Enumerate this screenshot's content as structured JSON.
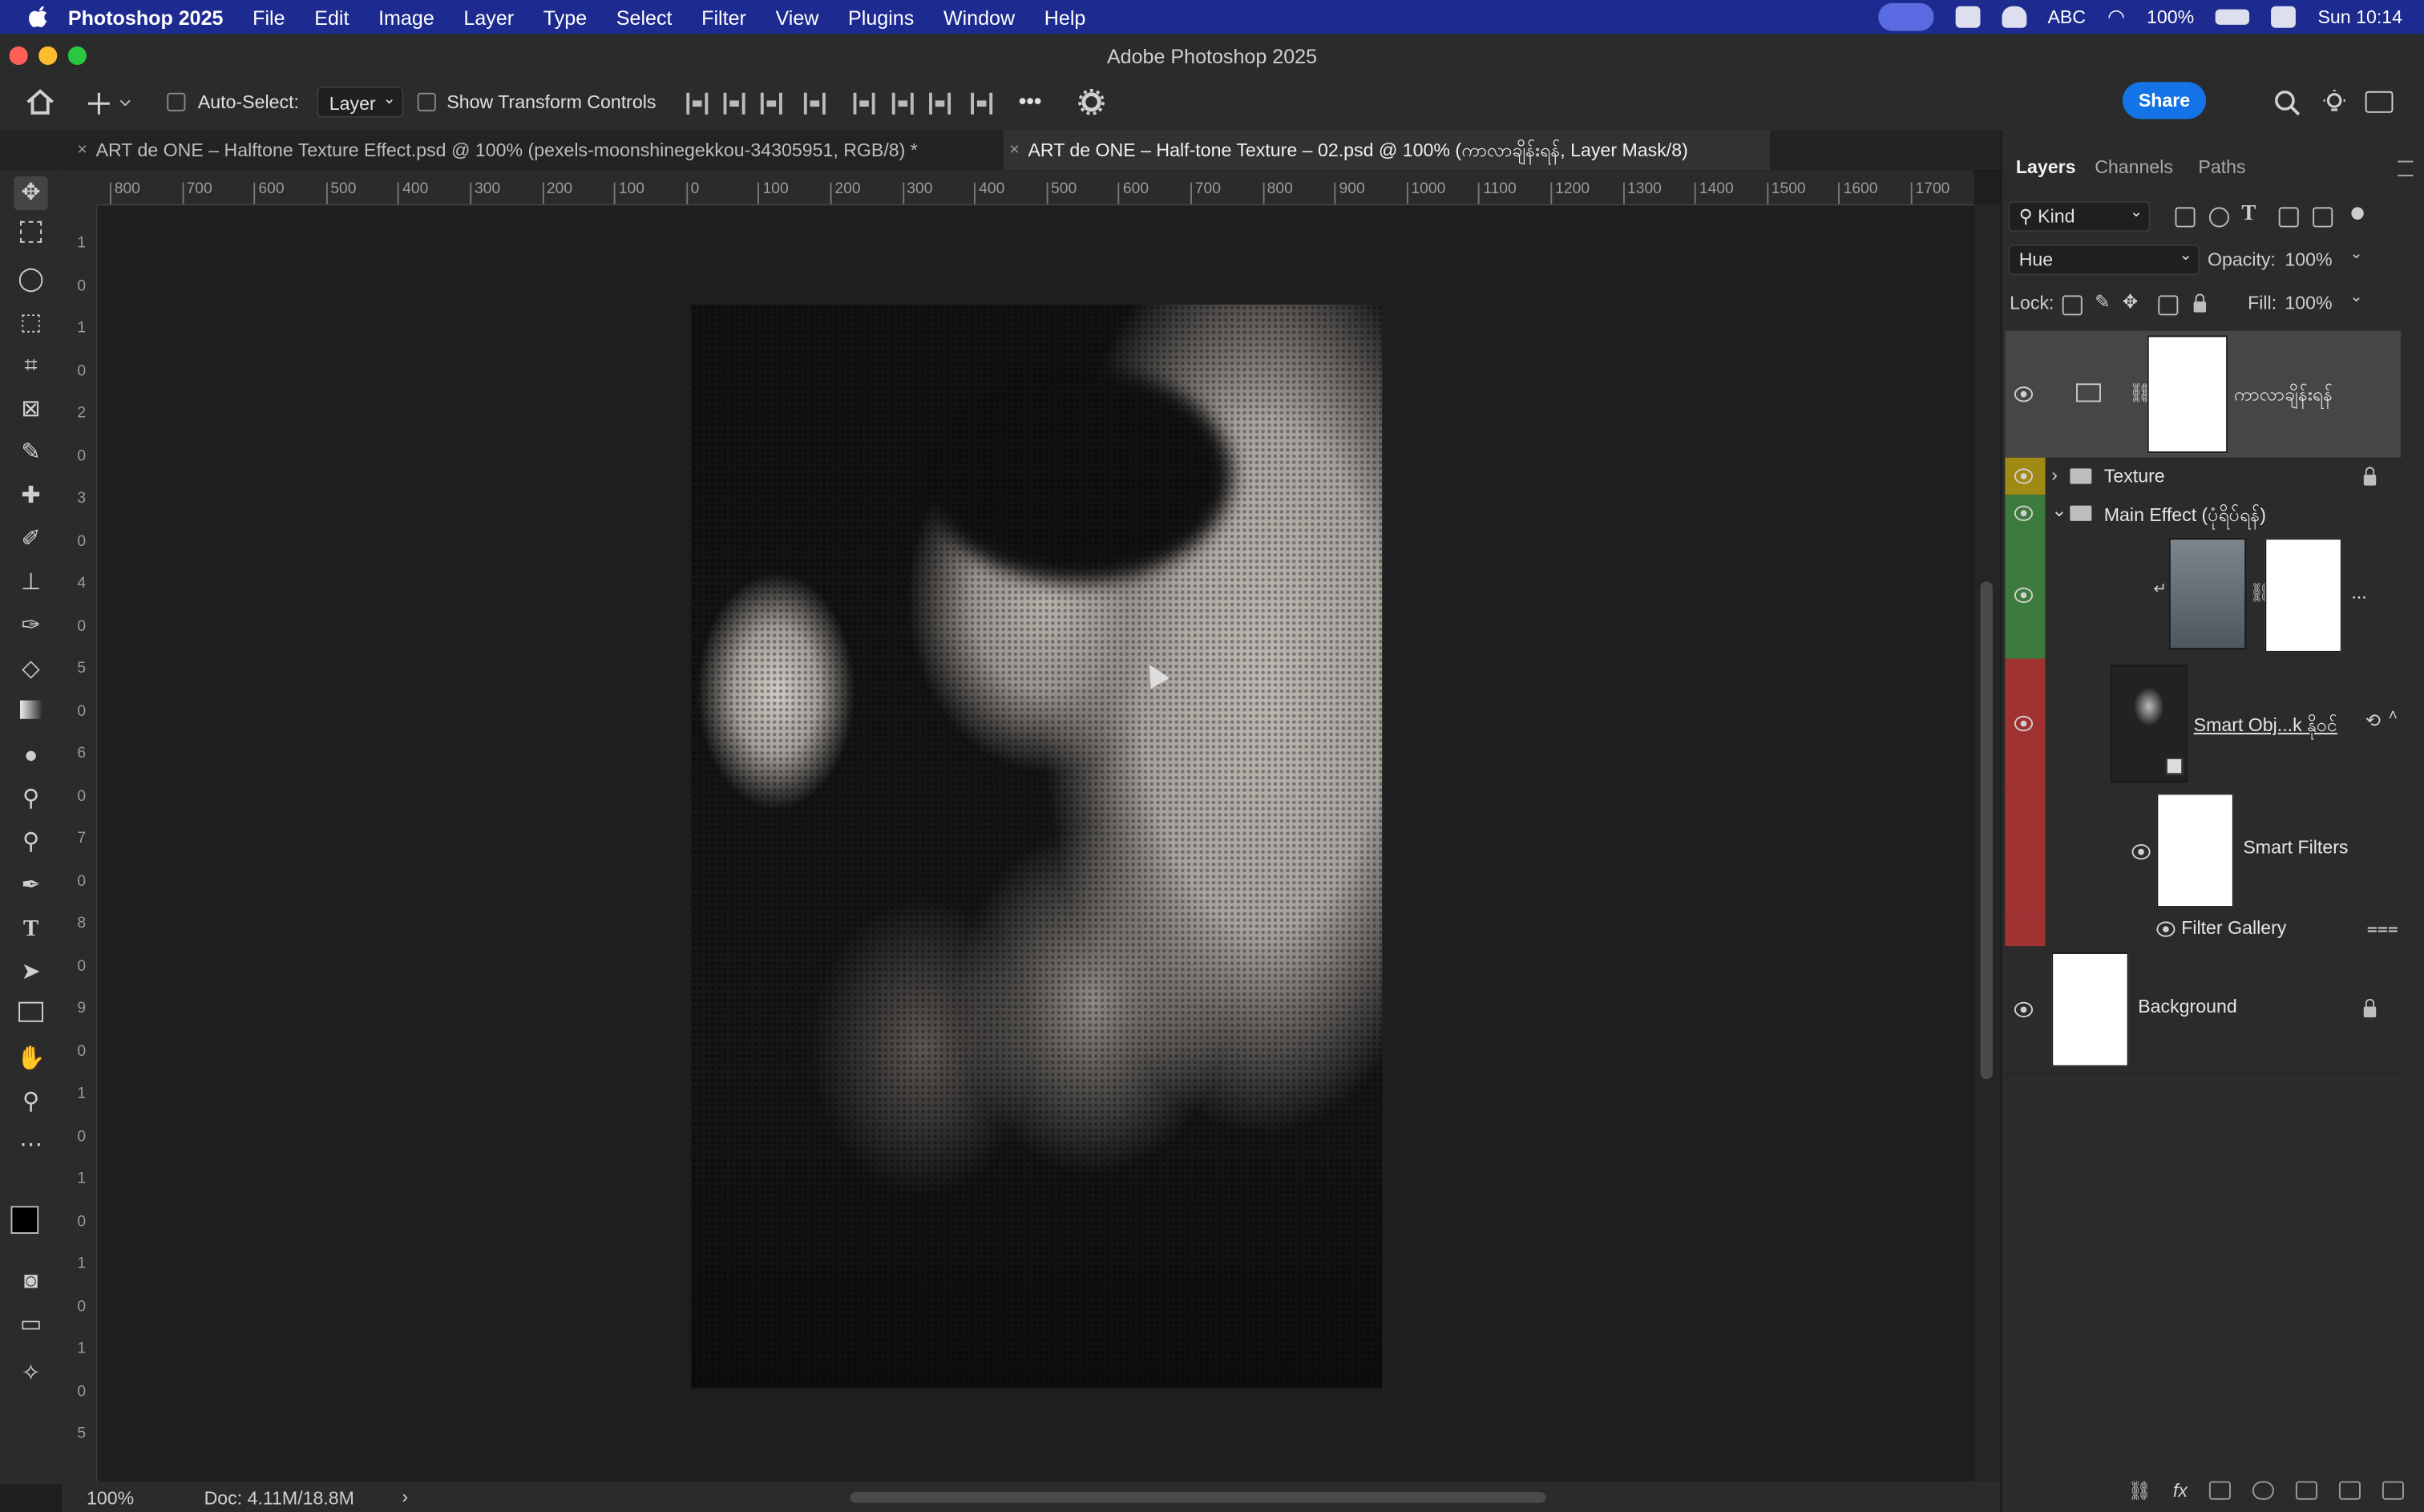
{
  "menubar": {
    "app_name": "Photoshop 2025",
    "items": [
      "File",
      "Edit",
      "Image",
      "Layer",
      "Type",
      "Select",
      "Filter",
      "View",
      "Plugins",
      "Window",
      "Help"
    ],
    "right": {
      "input_method": "ABC",
      "battery": "100%",
      "clock": "Sun 10:14"
    }
  },
  "window": {
    "title": "Adobe Photoshop 2025"
  },
  "options_bar": {
    "auto_select_label": "Auto-Select:",
    "auto_select_value": "Layer",
    "show_transform_label": "Show Transform Controls",
    "more_label": "•••",
    "share_label": "Share"
  },
  "tabs": [
    {
      "title": "ART de ONE – Halftone Texture Effect.psd @ 100% (pexels-moonshinegekkou-34305951, RGB/8) *",
      "active": false
    },
    {
      "title": "ART de ONE – Half-tone Texture – 02.psd @ 100% (ကာလာချိန်းရန်, Layer Mask/8)",
      "active": true
    }
  ],
  "ruler": {
    "h_labels": [
      "800",
      "700",
      "600",
      "500",
      "400",
      "300",
      "200",
      "100",
      "0",
      "100",
      "200",
      "300",
      "400",
      "500",
      "600",
      "700",
      "800",
      "900",
      "1000",
      "1100",
      "1200",
      "1300",
      "1400",
      "1500",
      "1600",
      "1700"
    ],
    "v_labels": [
      "1",
      "0",
      "1",
      "0",
      "2",
      "0",
      "3",
      "0",
      "4",
      "0",
      "5",
      "0",
      "6",
      "0",
      "7",
      "0",
      "8",
      "0",
      "9",
      "0",
      "1",
      "0",
      "1",
      "0",
      "1",
      "0",
      "1",
      "0",
      "5"
    ]
  },
  "status": {
    "zoom": "100%",
    "doc": "Doc: 4.11M/18.8M",
    "arrow": "›"
  },
  "panel": {
    "tabs": [
      "Layers",
      "Channels",
      "Paths"
    ],
    "filter_kind": "Kind",
    "blend_mode": "Hue",
    "opacity_label": "Opacity:",
    "opacity_value": "100%",
    "lock_label": "Lock:",
    "fill_label": "Fill:",
    "fill_value": "100%",
    "layers": [
      {
        "name": "ကာလာချိန်းရန်",
        "type": "adjustment"
      },
      {
        "name": "Texture",
        "type": "group",
        "color": "#a08a13"
      },
      {
        "name": "Main Effect (ပုံရိပ်ရန်)",
        "type": "group",
        "color": "#3d7a3d"
      },
      {
        "name": "",
        "type": "gradient-fill",
        "color": "#3d7a3d",
        "more": "..."
      },
      {
        "name": "Smart Obj...k နိုဝင်",
        "type": "smart-object",
        "color": "#a13232"
      },
      {
        "name": "Smart Filters",
        "type": "smart-filters",
        "color": "#a13232"
      },
      {
        "name": "Filter Gallery",
        "type": "filter",
        "color": "#a13232"
      },
      {
        "name": "Background",
        "type": "background"
      }
    ]
  },
  "colors": {
    "menubar": "#1d2a8f",
    "share": "#1473e6",
    "panel_bg": "#2b2b2b",
    "canvas_bg": "#1e1e1e"
  }
}
